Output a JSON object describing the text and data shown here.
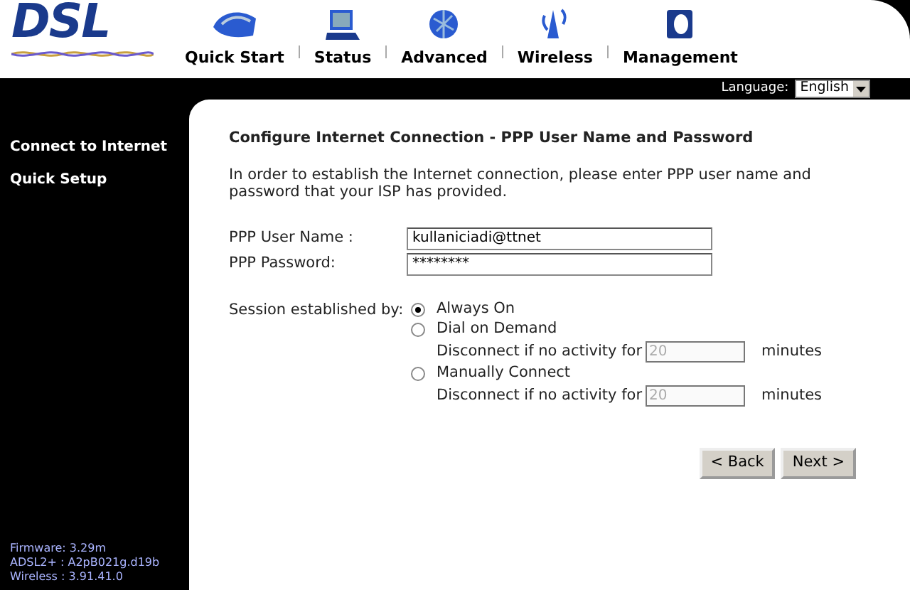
{
  "logo": "DSL",
  "nav": [
    {
      "label": "Quick Start"
    },
    {
      "label": "Status"
    },
    {
      "label": "Advanced"
    },
    {
      "label": "Wireless"
    },
    {
      "label": "Management"
    }
  ],
  "language": {
    "label": "Language:",
    "value": "English"
  },
  "sidebar": {
    "items": [
      {
        "label": "Connect to Internet"
      },
      {
        "label": "Quick Setup"
      }
    ],
    "versions": [
      "Firmware: 3.29m",
      "ADSL2+ : A2pB021g.d19b",
      "Wireless : 3.91.41.0"
    ]
  },
  "form": {
    "title": "Configure Internet Connection - PPP User Name and Password",
    "intro": "In order to establish the Internet connection, please enter PPP user name and password that your ISP has provided.",
    "fields": [
      {
        "label": "PPP User Name :",
        "value": "kullaniciadi@ttnet"
      },
      {
        "label": "PPP Password:",
        "value": "********"
      }
    ],
    "session_label": "Session established by:",
    "options": [
      {
        "label": "Always On",
        "selected": true
      },
      {
        "label": "Dial on Demand",
        "selected": false,
        "timeout": {
          "label": "Disconnect if no activity for",
          "value": "20",
          "unit": "minutes",
          "disabled": true
        }
      },
      {
        "label": "Manually Connect",
        "selected": false,
        "timeout": {
          "label": "Disconnect if no activity for",
          "value": "20",
          "unit": "minutes",
          "disabled": true
        }
      }
    ],
    "buttons": [
      "< Back",
      "Next >"
    ]
  }
}
